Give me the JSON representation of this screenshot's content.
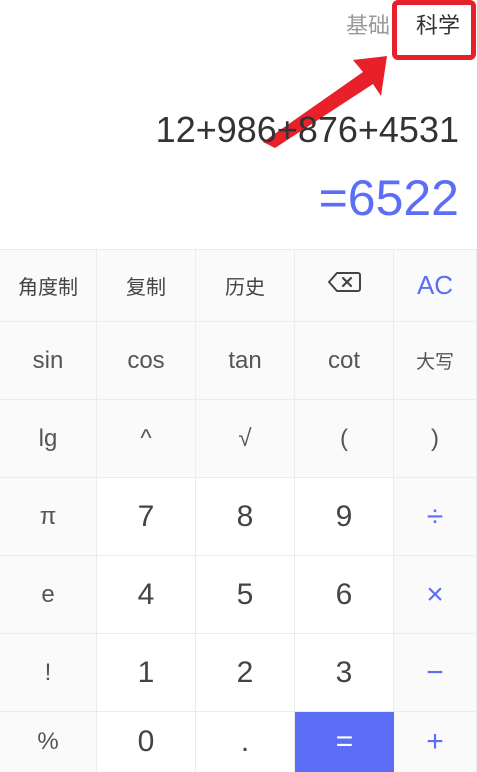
{
  "mode_tabs": {
    "basic": "基础",
    "scientific": "科学"
  },
  "display": {
    "expression": "12+986+876+4531",
    "result": "=6522"
  },
  "colors": {
    "accent": "#5b6ef5",
    "highlight": "#e8202a"
  },
  "keys": [
    {
      "name": "angle-mode-button",
      "label": "角度制",
      "kind": "cn"
    },
    {
      "name": "copy-button",
      "label": "复制",
      "kind": "cn"
    },
    {
      "name": "history-button",
      "label": "历史",
      "kind": "cn"
    },
    {
      "name": "backspace-button",
      "label": "",
      "kind": "backspace",
      "icon": "backspace-icon"
    },
    {
      "name": "all-clear-button",
      "label": "AC",
      "kind": "ac"
    },
    {
      "name": "sin-button",
      "label": "sin",
      "kind": "fn"
    },
    {
      "name": "cos-button",
      "label": "cos",
      "kind": "fn"
    },
    {
      "name": "tan-button",
      "label": "tan",
      "kind": "fn"
    },
    {
      "name": "cot-button",
      "label": "cot",
      "kind": "fn"
    },
    {
      "name": "uppercase-button",
      "label": "大写",
      "kind": "small-cn"
    },
    {
      "name": "lg-button",
      "label": "lg",
      "kind": "fn"
    },
    {
      "name": "power-button",
      "label": "^",
      "kind": "fn"
    },
    {
      "name": "sqrt-button",
      "label": "√",
      "kind": "fn"
    },
    {
      "name": "open-paren-button",
      "label": "(",
      "kind": "fn"
    },
    {
      "name": "close-paren-button",
      "label": ")",
      "kind": "fn"
    },
    {
      "name": "pi-button",
      "label": "π",
      "kind": "fn"
    },
    {
      "name": "digit-7-button",
      "label": "7",
      "kind": "num"
    },
    {
      "name": "digit-8-button",
      "label": "8",
      "kind": "num"
    },
    {
      "name": "digit-9-button",
      "label": "9",
      "kind": "num"
    },
    {
      "name": "divide-button",
      "label": "÷",
      "kind": "op"
    },
    {
      "name": "e-button",
      "label": "e",
      "kind": "fn"
    },
    {
      "name": "digit-4-button",
      "label": "4",
      "kind": "num"
    },
    {
      "name": "digit-5-button",
      "label": "5",
      "kind": "num"
    },
    {
      "name": "digit-6-button",
      "label": "6",
      "kind": "num"
    },
    {
      "name": "multiply-button",
      "label": "×",
      "kind": "op"
    },
    {
      "name": "factorial-button",
      "label": "!",
      "kind": "fn"
    },
    {
      "name": "digit-1-button",
      "label": "1",
      "kind": "num"
    },
    {
      "name": "digit-2-button",
      "label": "2",
      "kind": "num"
    },
    {
      "name": "digit-3-button",
      "label": "3",
      "kind": "num"
    },
    {
      "name": "minus-button",
      "label": "−",
      "kind": "op"
    },
    {
      "name": "percent-button",
      "label": "%",
      "kind": "fn"
    },
    {
      "name": "digit-0-button",
      "label": "0",
      "kind": "num"
    },
    {
      "name": "decimal-point-button",
      "label": ".",
      "kind": "num"
    },
    {
      "name": "equals-button",
      "label": "=",
      "kind": "eq"
    },
    {
      "name": "plus-button",
      "label": "+",
      "kind": "op"
    }
  ]
}
